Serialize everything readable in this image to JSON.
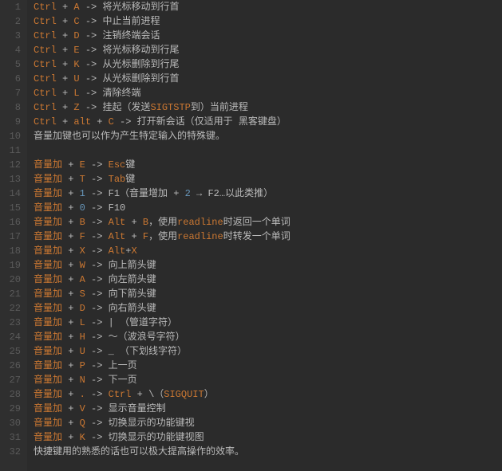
{
  "editor": {
    "lines": [
      {
        "n": 1,
        "tokens": [
          [
            "key",
            "Ctrl"
          ],
          [
            "plus",
            " + "
          ],
          [
            "key",
            "A"
          ],
          [
            "arrow",
            " -> "
          ],
          [
            "cjk",
            "将光标移动到行首"
          ]
        ]
      },
      {
        "n": 2,
        "tokens": [
          [
            "key",
            "Ctrl"
          ],
          [
            "plus",
            " + "
          ],
          [
            "key",
            "C"
          ],
          [
            "arrow",
            " -> "
          ],
          [
            "cjk",
            "中止当前进程"
          ]
        ]
      },
      {
        "n": 3,
        "tokens": [
          [
            "key",
            "Ctrl"
          ],
          [
            "plus",
            " + "
          ],
          [
            "key",
            "D"
          ],
          [
            "arrow",
            " -> "
          ],
          [
            "cjk",
            "注销终端会话"
          ]
        ]
      },
      {
        "n": 4,
        "tokens": [
          [
            "key",
            "Ctrl"
          ],
          [
            "plus",
            " + "
          ],
          [
            "key",
            "E"
          ],
          [
            "arrow",
            " -> "
          ],
          [
            "cjk",
            "将光标移动到行尾"
          ]
        ]
      },
      {
        "n": 5,
        "tokens": [
          [
            "key",
            "Ctrl"
          ],
          [
            "plus",
            " + "
          ],
          [
            "key",
            "K"
          ],
          [
            "arrow",
            " -> "
          ],
          [
            "cjk",
            "从光标删除到行尾"
          ]
        ]
      },
      {
        "n": 6,
        "tokens": [
          [
            "key",
            "Ctrl"
          ],
          [
            "plus",
            " + "
          ],
          [
            "key",
            "U"
          ],
          [
            "arrow",
            " -> "
          ],
          [
            "cjk",
            "从光标删除到行首"
          ]
        ]
      },
      {
        "n": 7,
        "tokens": [
          [
            "key",
            "Ctrl"
          ],
          [
            "plus",
            " + "
          ],
          [
            "key",
            "L"
          ],
          [
            "arrow",
            " -> "
          ],
          [
            "cjk",
            "清除终端"
          ]
        ]
      },
      {
        "n": 8,
        "tokens": [
          [
            "key",
            "Ctrl"
          ],
          [
            "plus",
            " + "
          ],
          [
            "key",
            "Z"
          ],
          [
            "arrow",
            " -> "
          ],
          [
            "cjk",
            "挂起（发送"
          ],
          [
            "kw",
            "SIGTSTP"
          ],
          [
            "cjk",
            "到）当前进程"
          ]
        ]
      },
      {
        "n": 9,
        "tokens": [
          [
            "key",
            "Ctrl"
          ],
          [
            "plus",
            " + "
          ],
          [
            "key",
            "alt"
          ],
          [
            "plus",
            " + "
          ],
          [
            "key",
            "C"
          ],
          [
            "arrow",
            " -> "
          ],
          [
            "cjk",
            "打开新会话（仅适用于 黑客键盘）"
          ]
        ]
      },
      {
        "n": 10,
        "tokens": [
          [
            "cjk",
            "音量加键也可以作为产生特定输入的特殊键。"
          ]
        ]
      },
      {
        "n": 11,
        "tokens": [
          [
            "default",
            ""
          ]
        ]
      },
      {
        "n": 12,
        "tokens": [
          [
            "key",
            "音量加"
          ],
          [
            "plus",
            " + "
          ],
          [
            "key",
            "E"
          ],
          [
            "arrow",
            " -> "
          ],
          [
            "kw",
            "Esc"
          ],
          [
            "cjk",
            "键"
          ]
        ]
      },
      {
        "n": 13,
        "tokens": [
          [
            "key",
            "音量加"
          ],
          [
            "plus",
            " + "
          ],
          [
            "key",
            "T"
          ],
          [
            "arrow",
            " -> "
          ],
          [
            "kw",
            "Tab"
          ],
          [
            "cjk",
            "键"
          ]
        ]
      },
      {
        "n": 14,
        "tokens": [
          [
            "key",
            "音量加"
          ],
          [
            "plus",
            " + "
          ],
          [
            "num",
            "1"
          ],
          [
            "arrow",
            " -> "
          ],
          [
            "default",
            "F1"
          ],
          [
            "cjk",
            "（音量增加 "
          ],
          [
            "plus",
            "+ "
          ],
          [
            "num",
            "2"
          ],
          [
            "default",
            " → F2…"
          ],
          [
            "cjk",
            "以此类推）"
          ]
        ]
      },
      {
        "n": 15,
        "tokens": [
          [
            "key",
            "音量加"
          ],
          [
            "plus",
            " + "
          ],
          [
            "num",
            "0"
          ],
          [
            "arrow",
            " -> "
          ],
          [
            "default",
            "F10"
          ]
        ]
      },
      {
        "n": 16,
        "tokens": [
          [
            "key",
            "音量加"
          ],
          [
            "plus",
            " + "
          ],
          [
            "key",
            "B"
          ],
          [
            "arrow",
            " -> "
          ],
          [
            "kw",
            "Alt"
          ],
          [
            "plus",
            " + "
          ],
          [
            "key",
            "B"
          ],
          [
            "cjk",
            "，使用"
          ],
          [
            "kw",
            "readline"
          ],
          [
            "cjk",
            "时返回一个单词"
          ]
        ]
      },
      {
        "n": 17,
        "tokens": [
          [
            "key",
            "音量加"
          ],
          [
            "plus",
            " + "
          ],
          [
            "key",
            "F"
          ],
          [
            "arrow",
            " -> "
          ],
          [
            "kw",
            "Alt"
          ],
          [
            "plus",
            " + "
          ],
          [
            "key",
            "F"
          ],
          [
            "cjk",
            "，使用"
          ],
          [
            "kw",
            "readline"
          ],
          [
            "cjk",
            "时转发一个单词"
          ]
        ]
      },
      {
        "n": 18,
        "tokens": [
          [
            "key",
            "音量加"
          ],
          [
            "plus",
            " + "
          ],
          [
            "key",
            "X"
          ],
          [
            "arrow",
            " -> "
          ],
          [
            "kw",
            "Alt"
          ],
          [
            "plus",
            "+"
          ],
          [
            "key",
            "X"
          ]
        ]
      },
      {
        "n": 19,
        "tokens": [
          [
            "key",
            "音量加"
          ],
          [
            "plus",
            " + "
          ],
          [
            "key",
            "W"
          ],
          [
            "arrow",
            " -> "
          ],
          [
            "cjk",
            "向上箭头键"
          ]
        ]
      },
      {
        "n": 20,
        "tokens": [
          [
            "key",
            "音量加"
          ],
          [
            "plus",
            " + "
          ],
          [
            "key",
            "A"
          ],
          [
            "arrow",
            " -> "
          ],
          [
            "cjk",
            "向左箭头键"
          ]
        ]
      },
      {
        "n": 21,
        "tokens": [
          [
            "key",
            "音量加"
          ],
          [
            "plus",
            " + "
          ],
          [
            "key",
            "S"
          ],
          [
            "arrow",
            " -> "
          ],
          [
            "cjk",
            "向下箭头键"
          ]
        ]
      },
      {
        "n": 22,
        "tokens": [
          [
            "key",
            "音量加"
          ],
          [
            "plus",
            " + "
          ],
          [
            "key",
            "D"
          ],
          [
            "arrow",
            " -> "
          ],
          [
            "cjk",
            "向右箭头键"
          ]
        ]
      },
      {
        "n": 23,
        "tokens": [
          [
            "key",
            "音量加"
          ],
          [
            "plus",
            " + "
          ],
          [
            "key",
            "L"
          ],
          [
            "arrow",
            " -> "
          ],
          [
            "punct",
            "| "
          ],
          [
            "cjk",
            "（管道字符）"
          ]
        ]
      },
      {
        "n": 24,
        "tokens": [
          [
            "key",
            "音量加"
          ],
          [
            "plus",
            " + "
          ],
          [
            "key",
            "H"
          ],
          [
            "arrow",
            " -> "
          ],
          [
            "punct",
            "〜"
          ],
          [
            "cjk",
            "（波浪号字符）"
          ]
        ]
      },
      {
        "n": 25,
        "tokens": [
          [
            "key",
            "音量加"
          ],
          [
            "plus",
            " + "
          ],
          [
            "key",
            "U"
          ],
          [
            "arrow",
            " -> "
          ],
          [
            "punct",
            "_ "
          ],
          [
            "cjk",
            "（下划线字符）"
          ]
        ]
      },
      {
        "n": 26,
        "tokens": [
          [
            "key",
            "音量加"
          ],
          [
            "plus",
            " + "
          ],
          [
            "key",
            "P"
          ],
          [
            "arrow",
            " -> "
          ],
          [
            "cjk",
            "上一页"
          ]
        ]
      },
      {
        "n": 27,
        "tokens": [
          [
            "key",
            "音量加"
          ],
          [
            "plus",
            " + "
          ],
          [
            "key",
            "N"
          ],
          [
            "arrow",
            " -> "
          ],
          [
            "cjk",
            "下一页"
          ]
        ]
      },
      {
        "n": 28,
        "tokens": [
          [
            "key",
            "音量加"
          ],
          [
            "plus",
            " + "
          ],
          [
            "key",
            "."
          ],
          [
            "arrow",
            " -> "
          ],
          [
            "key",
            "Ctrl"
          ],
          [
            "plus",
            " + "
          ],
          [
            "punct",
            "\\"
          ],
          [
            "cjk",
            "（"
          ],
          [
            "kw",
            "SIGQUIT"
          ],
          [
            "cjk",
            "）"
          ]
        ]
      },
      {
        "n": 29,
        "tokens": [
          [
            "key",
            "音量加"
          ],
          [
            "plus",
            " + "
          ],
          [
            "key",
            "V"
          ],
          [
            "arrow",
            " -> "
          ],
          [
            "cjk",
            "显示音量控制"
          ]
        ]
      },
      {
        "n": 30,
        "tokens": [
          [
            "key",
            "音量加"
          ],
          [
            "plus",
            " + "
          ],
          [
            "key",
            "Q"
          ],
          [
            "arrow",
            " -> "
          ],
          [
            "cjk",
            "切换显示的功能键视"
          ]
        ]
      },
      {
        "n": 31,
        "tokens": [
          [
            "key",
            "音量加"
          ],
          [
            "plus",
            " + "
          ],
          [
            "key",
            "K"
          ],
          [
            "arrow",
            " -> "
          ],
          [
            "cjk",
            "切换显示的功能键视图"
          ]
        ]
      },
      {
        "n": 32,
        "tokens": [
          [
            "cjk",
            "快捷键用的熟悉的话也可以极大提高操作的效率。"
          ]
        ]
      }
    ]
  }
}
